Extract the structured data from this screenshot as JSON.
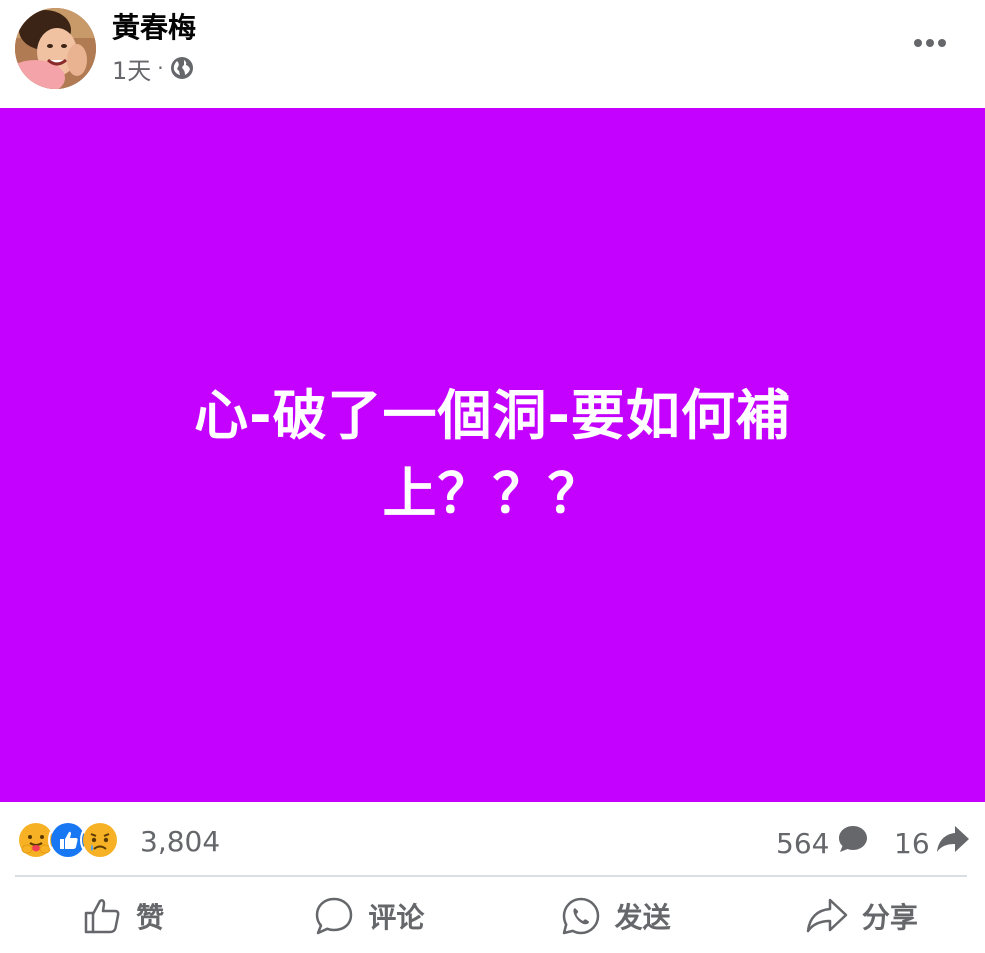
{
  "header": {
    "author": "黃春梅",
    "time": "1天",
    "separator": "·",
    "privacy_icon": "globe-icon",
    "more_icon": "more-options-icon"
  },
  "post": {
    "background_color": "#c400ff",
    "text_color": "#ffffff",
    "text_line_1": "心-破了一個洞-要如何補",
    "text_line_2": "上？？？"
  },
  "stats": {
    "reactions": [
      "care-reaction-icon",
      "like-reaction-icon",
      "sad-reaction-icon"
    ],
    "reaction_count": "3,804",
    "comment_count": "564",
    "share_count": "16"
  },
  "actions": {
    "like_label": "赞",
    "comment_label": "评论",
    "send_label": "发送",
    "share_label": "分享"
  },
  "colors": {
    "secondary_text": "#65676b",
    "divider": "#dadde1",
    "like_blue": "#1877f2"
  }
}
